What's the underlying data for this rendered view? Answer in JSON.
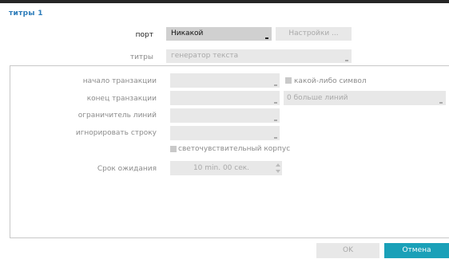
{
  "dialog": {
    "title": "титры 1"
  },
  "port": {
    "label": "порт",
    "value": "Никакой",
    "settings_label": "Настройки ..."
  },
  "titles": {
    "label": "титры",
    "value": "генератор текста"
  },
  "transaction_start": {
    "label": "начало транзакции",
    "value": ""
  },
  "any_symbol": {
    "label": "какой-либо символ",
    "checked": false
  },
  "transaction_end": {
    "label": "конец транзакции",
    "value": ""
  },
  "more_lines": {
    "value": "0 больше линий"
  },
  "line_delimiter": {
    "label": "ограничитель линий",
    "value": ""
  },
  "ignore_line": {
    "label": "игнорировать строку",
    "value": ""
  },
  "case_sensitive": {
    "label": "светочувствительный корпус",
    "checked": false
  },
  "timeout": {
    "label": "Срок ожидания",
    "value": "10 min. 00 сек."
  },
  "footer": {
    "ok_label": "OK",
    "cancel_label": "Отмена"
  },
  "colors": {
    "title": "#2b7bb9",
    "accent": "#1aa0b8",
    "top_bar": "#262626"
  }
}
